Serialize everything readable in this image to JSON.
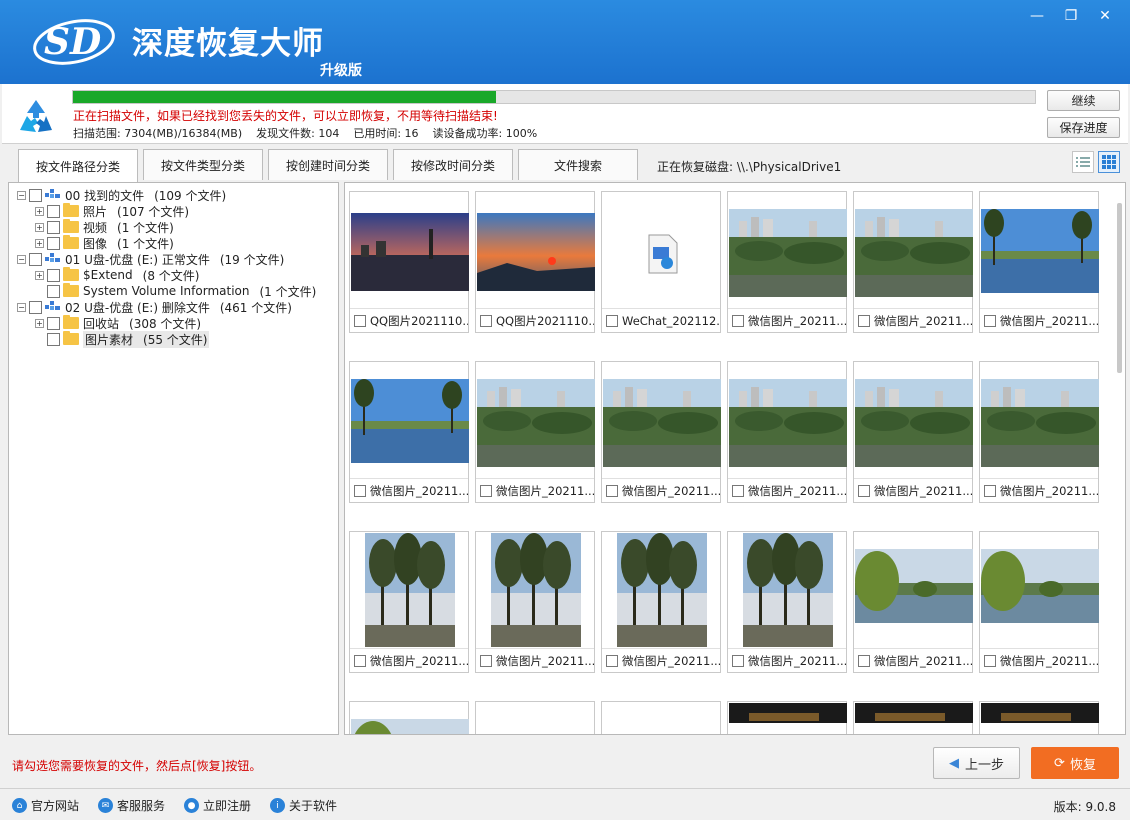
{
  "app": {
    "title": "深度恢复大师",
    "subtitle": "升级版",
    "logo_text": "SD"
  },
  "window_controls": [
    "minimize",
    "restore",
    "close"
  ],
  "scan": {
    "progress_fraction": 0.44,
    "message": "正在扫描文件，如果已经找到您丢失的文件，可以立即恢复，不用等待扫描结束!",
    "range": "扫描范围: 7304(MB)/16384(MB)",
    "found": "发现文件数: 104",
    "elapsed": "已用时间: 16",
    "success_rate": "读设备成功率: 100%",
    "continue_label": "继续",
    "save_label": "保存进度"
  },
  "tabs": [
    {
      "label": "按文件路径分类",
      "active": true
    },
    {
      "label": "按文件类型分类",
      "active": false
    },
    {
      "label": "按创建时间分类",
      "active": false
    },
    {
      "label": "按修改时间分类",
      "active": false
    },
    {
      "label": "文件搜索",
      "active": false
    }
  ],
  "drive_info": "正在恢复磁盘: \\\\.\\PhysicalDrive1",
  "tree": [
    {
      "label": "00 找到的文件",
      "count": "(109 个文件)",
      "level": 0,
      "icon": "drive-icon",
      "expanded": true
    },
    {
      "label": "照片",
      "count": "(107 个文件)",
      "level": 1,
      "icon": "folder-icon",
      "expanded": false
    },
    {
      "label": "视频",
      "count": "(1 个文件)",
      "level": 1,
      "icon": "folder-icon",
      "expanded": false
    },
    {
      "label": "图像",
      "count": "(1 个文件)",
      "level": 1,
      "icon": "folder-icon",
      "expanded": false
    },
    {
      "label": "01 U盘-优盘 (E:) 正常文件",
      "count": "(19 个文件)",
      "level": 0,
      "icon": "drive-icon",
      "expanded": true
    },
    {
      "label": "$Extend",
      "count": "(8 个文件)",
      "level": 1,
      "icon": "folder-icon",
      "expanded": false
    },
    {
      "label": "System Volume Information",
      "count": "(1 个文件)",
      "level": 1,
      "icon": "folder-icon",
      "expanded": null
    },
    {
      "label": "02 U盘-优盘 (E:) 删除文件",
      "count": "(461 个文件)",
      "level": 0,
      "icon": "drive-icon",
      "expanded": true
    },
    {
      "label": "回收站",
      "count": "(308 个文件)",
      "level": 1,
      "icon": "folder-icon",
      "expanded": false
    },
    {
      "label": "图片素材",
      "count": "(55 个文件)",
      "level": 1,
      "icon": "folder-icon",
      "expanded": null,
      "selected": true
    }
  ],
  "files": [
    {
      "name": "QQ图片2021110...",
      "thumb": "sunset-city"
    },
    {
      "name": "QQ图片2021110...",
      "thumb": "sunset-sky"
    },
    {
      "name": "WeChat_202112...",
      "thumb": "video-file-icon"
    },
    {
      "name": "微信图片_20211...",
      "thumb": "park-city"
    },
    {
      "name": "微信图片_20211...",
      "thumb": "park-city"
    },
    {
      "name": "微信图片_20211...",
      "thumb": "lake-trees"
    },
    {
      "name": "微信图片_20211...",
      "thumb": "lake-trees"
    },
    {
      "name": "微信图片_20211...",
      "thumb": "park-city"
    },
    {
      "name": "微信图片_20211...",
      "thumb": "park-city"
    },
    {
      "name": "微信图片_20211...",
      "thumb": "park-city"
    },
    {
      "name": "微信图片_20211...",
      "thumb": "park-city"
    },
    {
      "name": "微信图片_20211...",
      "thumb": "park-city"
    },
    {
      "name": "微信图片_20211...",
      "thumb": "tall-trees"
    },
    {
      "name": "微信图片_20211...",
      "thumb": "tall-trees"
    },
    {
      "name": "微信图片_20211...",
      "thumb": "tall-trees"
    },
    {
      "name": "微信图片_20211...",
      "thumb": "tall-trees"
    },
    {
      "name": "微信图片_20211...",
      "thumb": "willow-lake"
    },
    {
      "name": "微信图片_20211...",
      "thumb": "willow-lake"
    },
    {
      "name": "",
      "thumb": "willow-lake"
    },
    {
      "name": "",
      "thumb": "blank"
    },
    {
      "name": "",
      "thumb": "blank"
    },
    {
      "name": "",
      "thumb": "night"
    },
    {
      "name": "",
      "thumb": "night"
    },
    {
      "name": "",
      "thumb": "night"
    }
  ],
  "hint": "请勾选您需要恢复的文件，然后点[恢复]按钮。",
  "buttons": {
    "back": "上一步",
    "recover": "恢复"
  },
  "footer": {
    "links": [
      "官方网站",
      "客服服务",
      "立即注册",
      "关于软件"
    ],
    "version": "版本: 9.0.8"
  }
}
